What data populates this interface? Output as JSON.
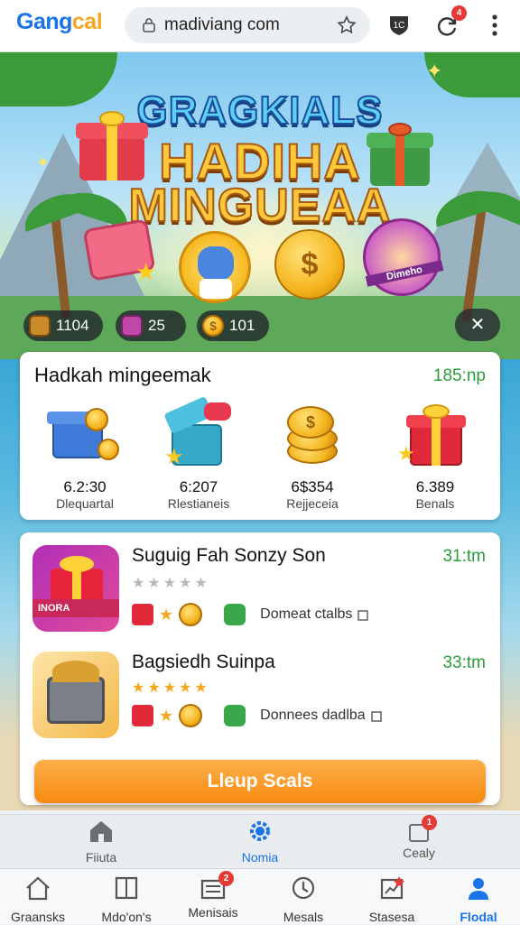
{
  "browser": {
    "brand_part1": "Gang",
    "brand_part2": "cal",
    "url": "madiviang com",
    "notification_count": "4"
  },
  "hero": {
    "title_line1": "GRAGKIALS",
    "title_line2": "HADIHA",
    "title_line3": "MINGUEAA",
    "character_badge": "Dimeho",
    "stats": [
      {
        "icon": "chest-icon",
        "value": "1104"
      },
      {
        "icon": "dice-icon",
        "value": "25"
      },
      {
        "icon": "coin-icon",
        "value": "101"
      }
    ],
    "close_symbol": "✕"
  },
  "rewards": {
    "title": "Hadkah mingeemak",
    "time": "185:np",
    "items": [
      {
        "value": "6.2:30",
        "label": "Dlequartal",
        "icon": "gift-coins-icon"
      },
      {
        "value": "6:207",
        "label": "Rlestianeis",
        "icon": "open-gift-icon"
      },
      {
        "value": "6$354",
        "label": "Rejjeceia",
        "icon": "coin-stack-icon"
      },
      {
        "value": "6.389",
        "label": "Benals",
        "icon": "gift-box-icon"
      }
    ]
  },
  "offers": [
    {
      "title": "Suguig Fah Sonzy Son",
      "time": "31:tm",
      "thumb_label": "INORA",
      "stars": "★★★★★",
      "detail": "Domeat ctalbs"
    },
    {
      "title": "Bagsiedh Suinpa",
      "time": "33:tm",
      "stars": "★★★★★",
      "detail": "Donnees dadlba"
    }
  ],
  "cta_label": "Lleup Scals",
  "sub_tabs": [
    {
      "label": "Fiiuta",
      "icon": "house-icon"
    },
    {
      "label": "Nomia",
      "icon": "gear-icon"
    },
    {
      "label": "Cealy",
      "icon": "calendar-icon",
      "badge": "1"
    }
  ],
  "bottom_nav": [
    {
      "label": "Graansks",
      "icon": "home-icon"
    },
    {
      "label": "Mdo'on's",
      "icon": "book-icon"
    },
    {
      "label": "Menisais",
      "icon": "inbox-icon",
      "badge": "2"
    },
    {
      "label": "Mesals",
      "icon": "clock-icon"
    },
    {
      "label": "Stasesa",
      "icon": "chart-icon"
    },
    {
      "label": "Flodal",
      "icon": "person-icon"
    }
  ],
  "colors": {
    "accent_green": "#2a9d3a",
    "cta_orange": "#f58a12",
    "active_blue": "#1a73e8"
  }
}
